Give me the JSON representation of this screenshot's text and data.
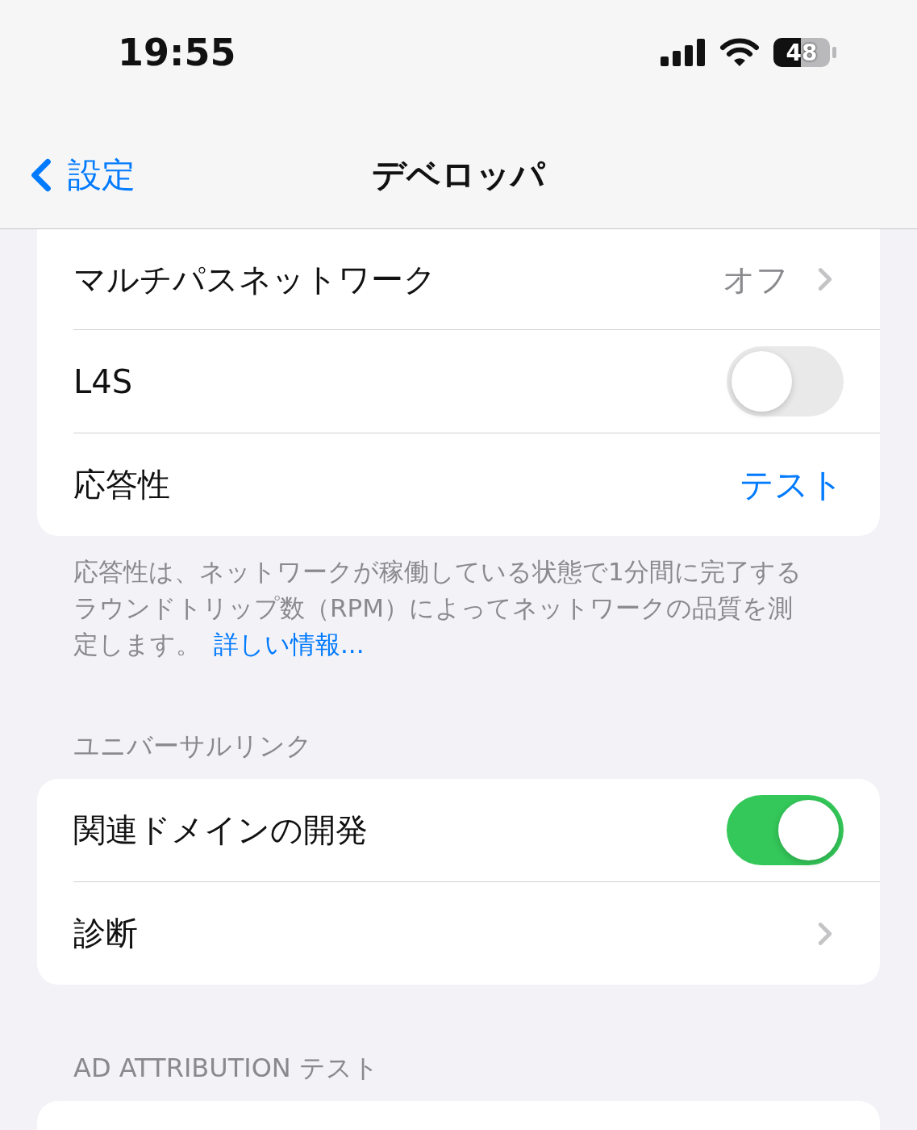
{
  "status_bar": {
    "time": "19:55",
    "battery": "48"
  },
  "nav": {
    "back_label": "設定",
    "title": "デベロッパ"
  },
  "sections": [
    {
      "rows": [
        {
          "kind": "value",
          "label": "マルチパスネットワーク",
          "value": "オフ"
        },
        {
          "kind": "toggle",
          "label": "L4S",
          "on": false
        },
        {
          "kind": "action",
          "label": "応答性",
          "action": "テスト"
        }
      ],
      "footer": {
        "text": "応答性は、ネットワークが稼働している状態で1分間に完了するラウンドトリップ数（RPM）によってネットワークの品質を測定します。",
        "link": "詳しい情報..."
      }
    },
    {
      "header": "ユニバーサルリンク",
      "rows": [
        {
          "kind": "toggle",
          "label": "関連ドメインの開発",
          "on": true
        },
        {
          "kind": "nav",
          "label": "診断"
        }
      ]
    },
    {
      "header": "AD ATTRIBUTION テスト"
    }
  ]
}
